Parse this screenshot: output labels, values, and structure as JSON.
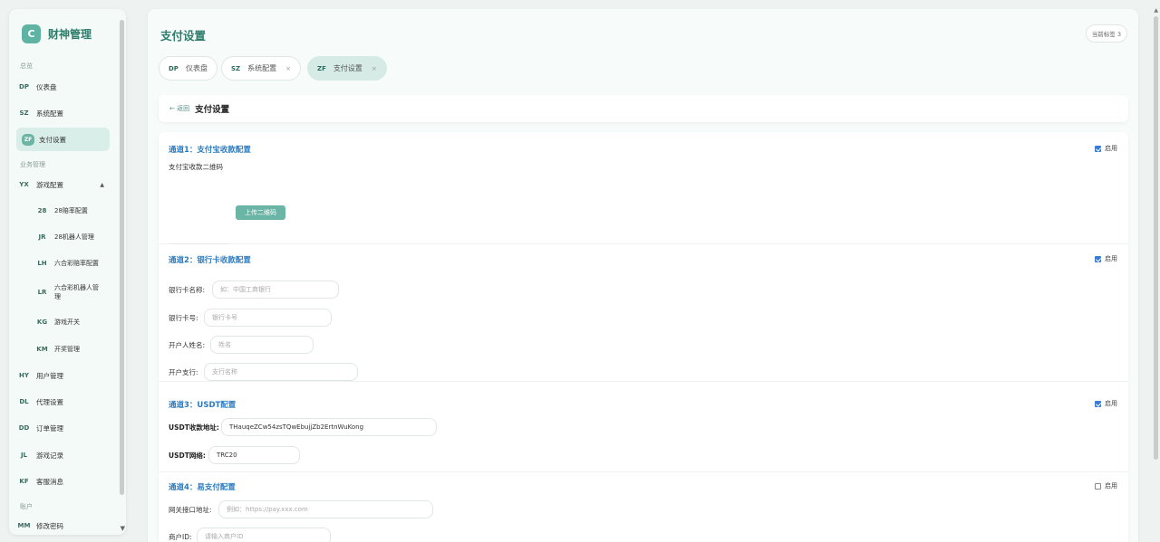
{
  "brand": {
    "logo_letter": "C",
    "name": "财神管理"
  },
  "sidebar": {
    "sections": [
      "总览",
      "业务管理",
      "账户"
    ],
    "items": [
      {
        "code": "DP",
        "label": "仪表盘"
      },
      {
        "code": "SZ",
        "label": "系统配置"
      },
      {
        "code": "ZF",
        "label": "支付设置"
      },
      {
        "code": "YX",
        "label": "游戏配置",
        "arrow": "▲"
      },
      {
        "code": "28",
        "label": "28赔率配置"
      },
      {
        "code": "JR",
        "label": "28机器人管理"
      },
      {
        "code": "LH",
        "label": "六合彩赔率配置"
      },
      {
        "code": "LR",
        "label": "六合彩机器人管理"
      },
      {
        "code": "KG",
        "label": "游戏开关"
      },
      {
        "code": "KM",
        "label": "开奖管理"
      },
      {
        "code": "HY",
        "label": "用户管理"
      },
      {
        "code": "DL",
        "label": "代理设置"
      },
      {
        "code": "DD",
        "label": "订单管理"
      },
      {
        "code": "JL",
        "label": "游戏记录"
      },
      {
        "code": "KF",
        "label": "客服消息"
      },
      {
        "code": "MM",
        "label": "修改密码"
      }
    ]
  },
  "main": {
    "page_title": "支付设置",
    "tab_count": "当前标签 3",
    "tabs": [
      {
        "code": "DP",
        "label": "仪表盘",
        "close": ""
      },
      {
        "code": "SZ",
        "label": "系统配置",
        "close": "×"
      },
      {
        "code": "ZF",
        "label": "支付设置",
        "close": "×"
      }
    ],
    "back_label": "← 返回",
    "header_title": "支付设置"
  },
  "channels": {
    "alipay": {
      "title": "通道1：支付宝收款配置",
      "enable_label": "启用",
      "enabled": true,
      "qr_label": "支付宝收款二维码",
      "upload_label": "上传二维码"
    },
    "bank": {
      "title": "通道2：银行卡收款配置",
      "enable_label": "启用",
      "enabled": true,
      "fields": [
        {
          "label": "银行卡名称:",
          "placeholder": "如：中国工商银行"
        },
        {
          "label": "银行卡号:",
          "placeholder": "银行卡号"
        },
        {
          "label": "开户人姓名:",
          "placeholder": "姓名"
        },
        {
          "label": "开户支行:",
          "placeholder": "支行名称"
        }
      ]
    },
    "usdt": {
      "title": "通道3：USDT配置",
      "enable_label": "启用",
      "enabled": true,
      "address_label": "USDT收款地址:",
      "address_value": "THauqeZCw54zsTQwEbujjZb2ErtnWuKong",
      "network_label": "USDT网络:",
      "network_value": "TRC20"
    },
    "epay": {
      "title": "通道4：易支付配置",
      "enable_label": "启用",
      "enabled": false,
      "gateway_label": "网关接口地址:",
      "gateway_placeholder": "例如：https://pay.xxx.com",
      "merchant_label": "商户ID:",
      "merchant_placeholder": "请输入商户ID"
    }
  },
  "colors": {
    "accent": "#5fb3a3",
    "title_blue": "#2c7bbf",
    "checkbox": "#3b7bd3"
  }
}
